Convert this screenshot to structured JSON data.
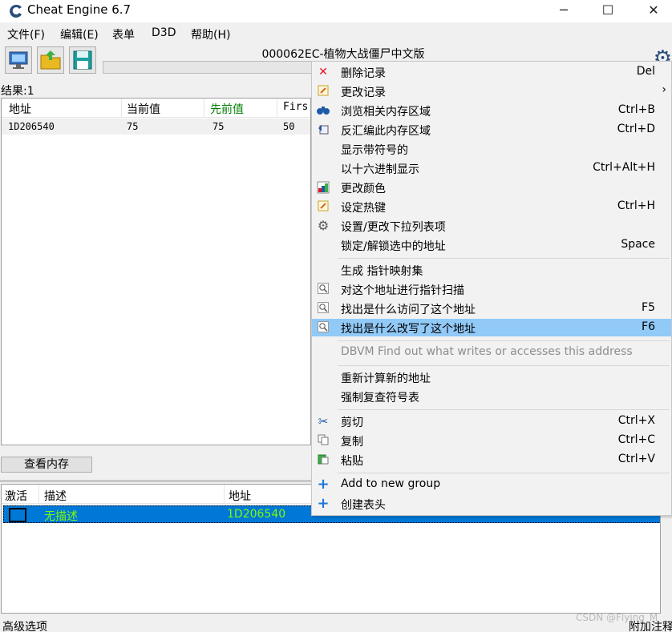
{
  "window": {
    "title": "Cheat Engine 6.7",
    "minimize_glyph": "─",
    "maximize_glyph": "☐",
    "close_glyph": "✕"
  },
  "menubar": {
    "items": [
      "文件(F)",
      "编辑(E)",
      "表单",
      "D3D",
      "帮助(H)"
    ]
  },
  "toolbar": {
    "process_title": "000062EC-植物大战僵尸中文版"
  },
  "scan": {
    "results_label": "结果:1",
    "columns": [
      "地址",
      "当前值",
      "先前值",
      "Firs"
    ],
    "rows": [
      {
        "address": "1D206540",
        "current": "75",
        "previous": "75",
        "first": "50"
      }
    ],
    "view_memory_button": "查看内存"
  },
  "address_list": {
    "columns": [
      "激活",
      "描述",
      "地址"
    ],
    "rows": [
      {
        "description": "无描述",
        "address": "1D206540"
      }
    ]
  },
  "bottom": {
    "advanced_options": "高级选项",
    "add_comment": "附加注释"
  },
  "watermark": "CSDN @Flying_M",
  "context_menu": {
    "items": [
      {
        "label": "删除记录",
        "shortcut": "Del",
        "icon": "delete-x-icon"
      },
      {
        "label": "更改记录",
        "shortcut": "",
        "icon": "edit-note-icon"
      },
      {
        "label": "浏览相关内存区域",
        "shortcut": "Ctrl+B",
        "icon": "binoculars-icon"
      },
      {
        "label": "反汇编此内存区域",
        "shortcut": "Ctrl+D",
        "icon": "disassemble-icon"
      },
      {
        "label": "显示带符号的",
        "shortcut": "",
        "icon": ""
      },
      {
        "label": "以十六进制显示",
        "shortcut": "Ctrl+Alt+H",
        "icon": ""
      },
      {
        "label": "更改颜色",
        "shortcut": "",
        "icon": "color-palette-icon"
      },
      {
        "label": "设定热键",
        "shortcut": "Ctrl+H",
        "icon": "hotkey-icon"
      },
      {
        "label": "设置/更改下拉列表项",
        "shortcut": "",
        "icon": "gear-icon"
      },
      {
        "label": "锁定/解锁选中的地址",
        "shortcut": "Space",
        "icon": ""
      },
      {
        "label": "生成 指针映射集",
        "shortcut": "",
        "icon": ""
      },
      {
        "label": "对这个地址进行指针扫描",
        "shortcut": "",
        "icon": "magnifier-icon"
      },
      {
        "label": "找出是什么访问了这个地址",
        "shortcut": "F5",
        "icon": "magnifier-icon"
      },
      {
        "label": "找出是什么改写了这个地址",
        "shortcut": "F6",
        "icon": "magnifier-icon"
      },
      {
        "label": "DBVM Find out what writes or accesses this address",
        "shortcut": "",
        "icon": ""
      },
      {
        "label": "重新计算新的地址",
        "shortcut": "",
        "icon": ""
      },
      {
        "label": "强制复查符号表",
        "shortcut": "",
        "icon": ""
      },
      {
        "label": "剪切",
        "shortcut": "Ctrl+X",
        "icon": "scissors-icon"
      },
      {
        "label": "复制",
        "shortcut": "Ctrl+C",
        "icon": "copy-icon"
      },
      {
        "label": "粘贴",
        "shortcut": "Ctrl+V",
        "icon": "paste-icon"
      },
      {
        "label": "Add to new group",
        "shortcut": "",
        "icon": "plus-icon"
      },
      {
        "label": "创建表头",
        "shortcut": "",
        "icon": "plus-icon"
      }
    ]
  },
  "colors": {
    "highlight": "#91c9f7",
    "selected_row": "#0078d7",
    "selected_text": "#7cfc00",
    "previous_value_header": "#008000",
    "delete_icon": "#e81123"
  }
}
